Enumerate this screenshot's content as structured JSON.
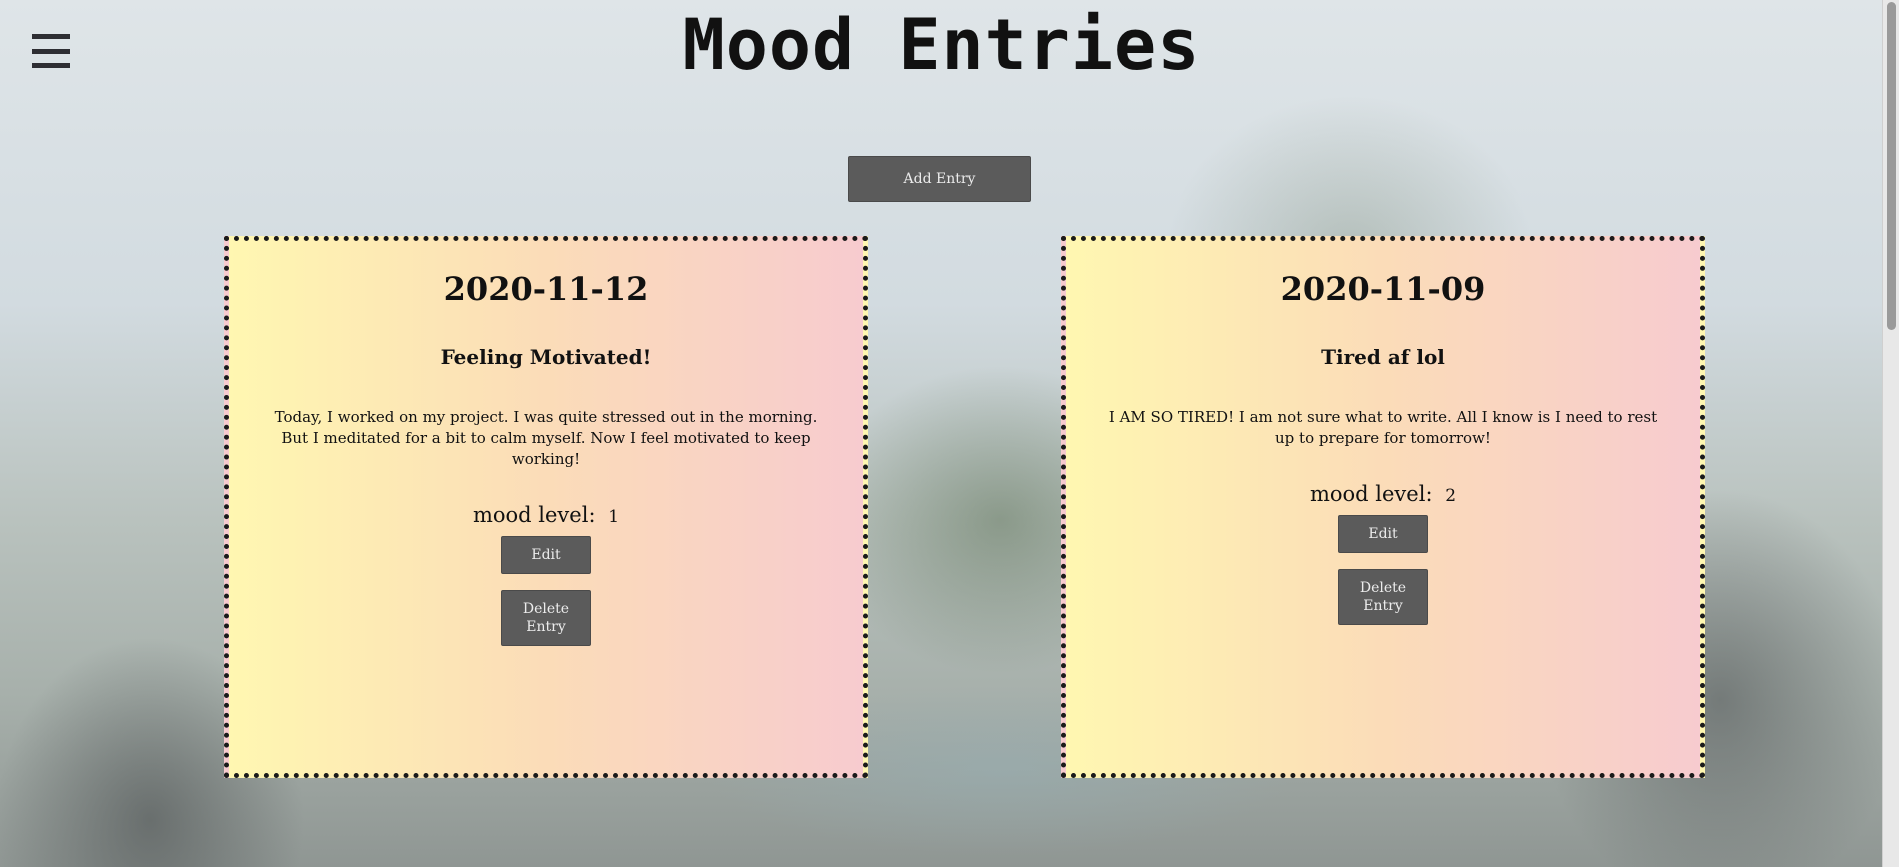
{
  "page": {
    "title": "Mood Entries",
    "add_entry_label": "Add Entry"
  },
  "entries": [
    {
      "date": "2020-11-12",
      "title": "Feeling Motivated!",
      "body": "Today, I worked on my project. I was quite stressed out in the morning. But I meditated for a bit to calm myself. Now I feel motivated to keep working!",
      "mood_label": "mood level:",
      "mood_value": "1",
      "edit_label": "Edit",
      "delete_label": "Delete Entry"
    },
    {
      "date": "2020-11-09",
      "title": "Tired af lol",
      "body": "I AM SO TIRED! I am not sure what to write. All I know is I need to rest up to prepare for tomorrow!",
      "mood_label": "mood level:",
      "mood_value": "2",
      "edit_label": "Edit",
      "delete_label": "Delete Entry"
    }
  ],
  "colors": {
    "button_bg": "#5b5b5b",
    "card_gradient_start": "#fff7b1",
    "card_gradient_end": "#f7cbcf"
  },
  "icons": {
    "menu": "hamburger-menu-icon"
  }
}
